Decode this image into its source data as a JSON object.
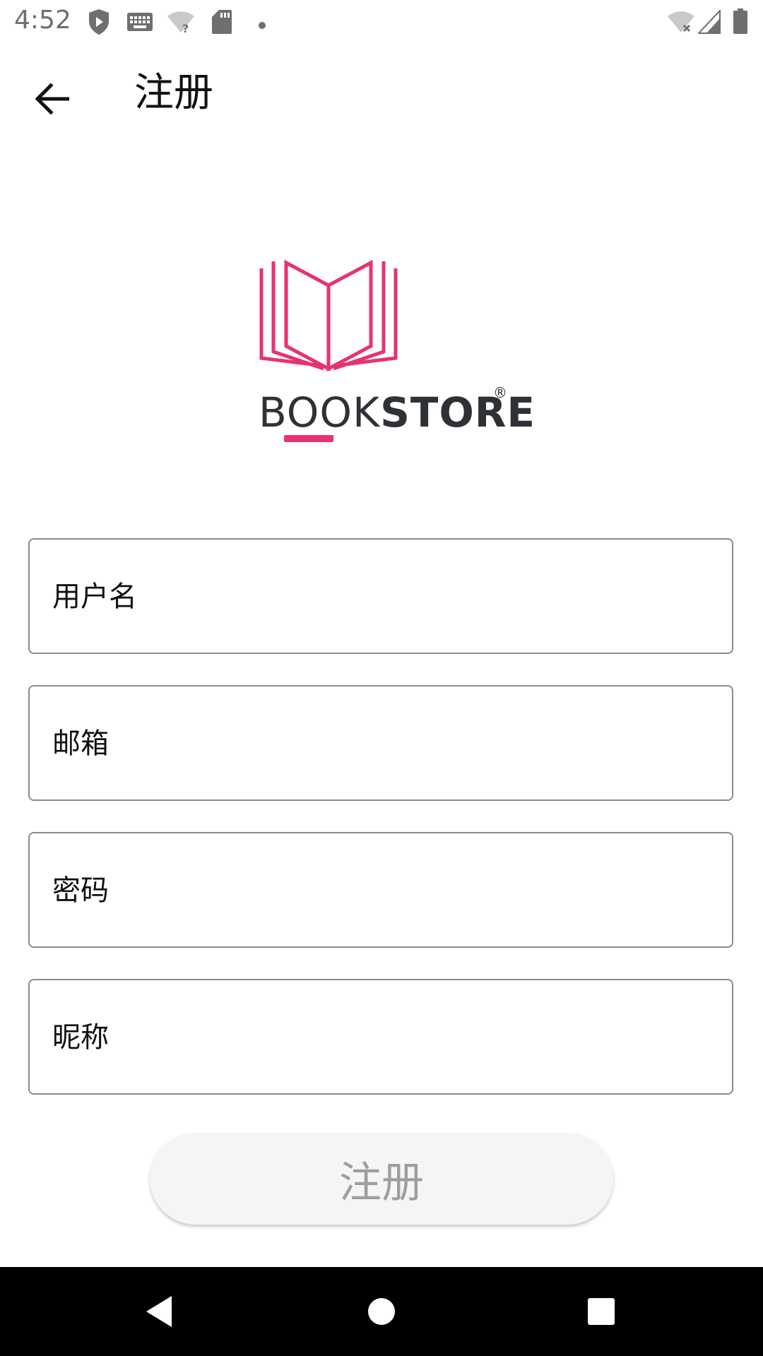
{
  "status_bar": {
    "time": "4:52"
  },
  "app_bar": {
    "title": "注册",
    "back_icon": "arrow-back-icon"
  },
  "logo": {
    "text_light": "BOOK",
    "text_bold": "STORE",
    "registered": "®",
    "color": "#e6336e"
  },
  "form": {
    "fields": [
      {
        "placeholder": "用户名",
        "value": ""
      },
      {
        "placeholder": "邮箱",
        "value": ""
      },
      {
        "placeholder": "密码",
        "value": ""
      },
      {
        "placeholder": "昵称",
        "value": ""
      }
    ],
    "submit_label": "注册"
  },
  "nav_bar": {
    "icons": [
      "back-triangle-icon",
      "home-circle-icon",
      "recents-square-icon"
    ]
  }
}
